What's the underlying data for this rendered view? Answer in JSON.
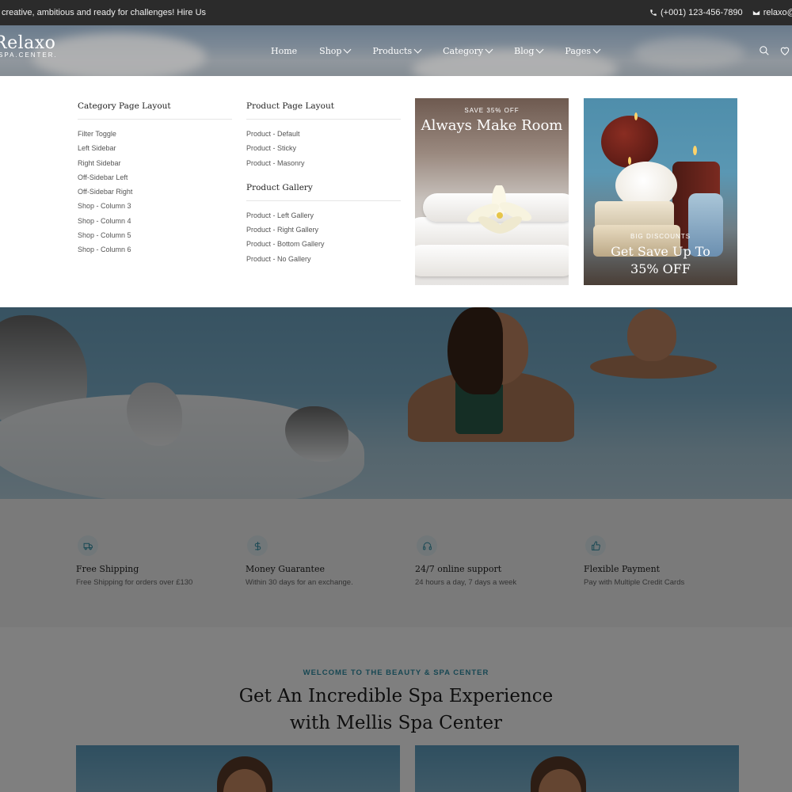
{
  "topbar": {
    "tagline": "creative, ambitious and ready for challenges! Hire Us",
    "phone": "(+001) 123-456-7890",
    "email": "relaxo@te",
    "phone_icon": "phone-icon",
    "email_icon": "envelope-icon"
  },
  "header": {
    "logo_main": "Relaxo",
    "logo_sub": "SPA.CENTER.",
    "nav": [
      {
        "label": "Home",
        "has_dropdown": false
      },
      {
        "label": "Shop",
        "has_dropdown": true
      },
      {
        "label": "Products",
        "has_dropdown": true
      },
      {
        "label": "Category",
        "has_dropdown": true
      },
      {
        "label": "Blog",
        "has_dropdown": true
      },
      {
        "label": "Pages",
        "has_dropdown": true
      }
    ],
    "icons": [
      "search-icon",
      "heart-icon"
    ]
  },
  "mega_menu": {
    "col1": {
      "title": "Category Page Layout",
      "links": [
        "Filter Toggle",
        "Left Sidebar",
        "Right Sidebar",
        "Off-Sidebar Left",
        "Off-Sidebar Right",
        "Shop - Column 3",
        "Shop - Column 4",
        "Shop - Column 5",
        "Shop - Column 6"
      ]
    },
    "col2": {
      "title": "Product Page Layout",
      "links": [
        "Product - Default",
        "Product - Sticky",
        "Product - Masonry"
      ]
    },
    "col2b": {
      "title": "Product Gallery",
      "links": [
        "Product - Left Gallery",
        "Product - Right Gallery",
        "Product - Bottom Gallery",
        "Product - No Gallery"
      ]
    },
    "promo1": {
      "tag": "SAVE 35% OFF",
      "headline": "Always Make Room"
    },
    "promo2": {
      "tag": "BIG DISCOUNTS",
      "headline_line1": "Get Save Up To",
      "headline_line2": "35% OFF"
    }
  },
  "features": [
    {
      "icon": "truck-icon",
      "title": "Free Shipping",
      "subtitle": "Free Shipping for orders over £130"
    },
    {
      "icon": "dollar-icon",
      "title": "Money Guarantee",
      "subtitle": "Within 30 days for an exchange."
    },
    {
      "icon": "headset-icon",
      "title": "24/7 online support",
      "subtitle": "24 hours a day, 7 days a week"
    },
    {
      "icon": "thumbs-up-icon",
      "title": "Flexible Payment",
      "subtitle": "Pay with Multiple Credit Cards"
    }
  ],
  "welcome": {
    "kicker": "WELCOME TO THE BEAUTY & SPA CENTER",
    "title_line1": "Get An Incredible Spa Experience",
    "title_line2": "with Mellis Spa Center"
  },
  "colors": {
    "accent": "#2f8fa6",
    "topbar": "#2b2b2b",
    "overlay": "rgba(0,0,0,0.5)"
  }
}
